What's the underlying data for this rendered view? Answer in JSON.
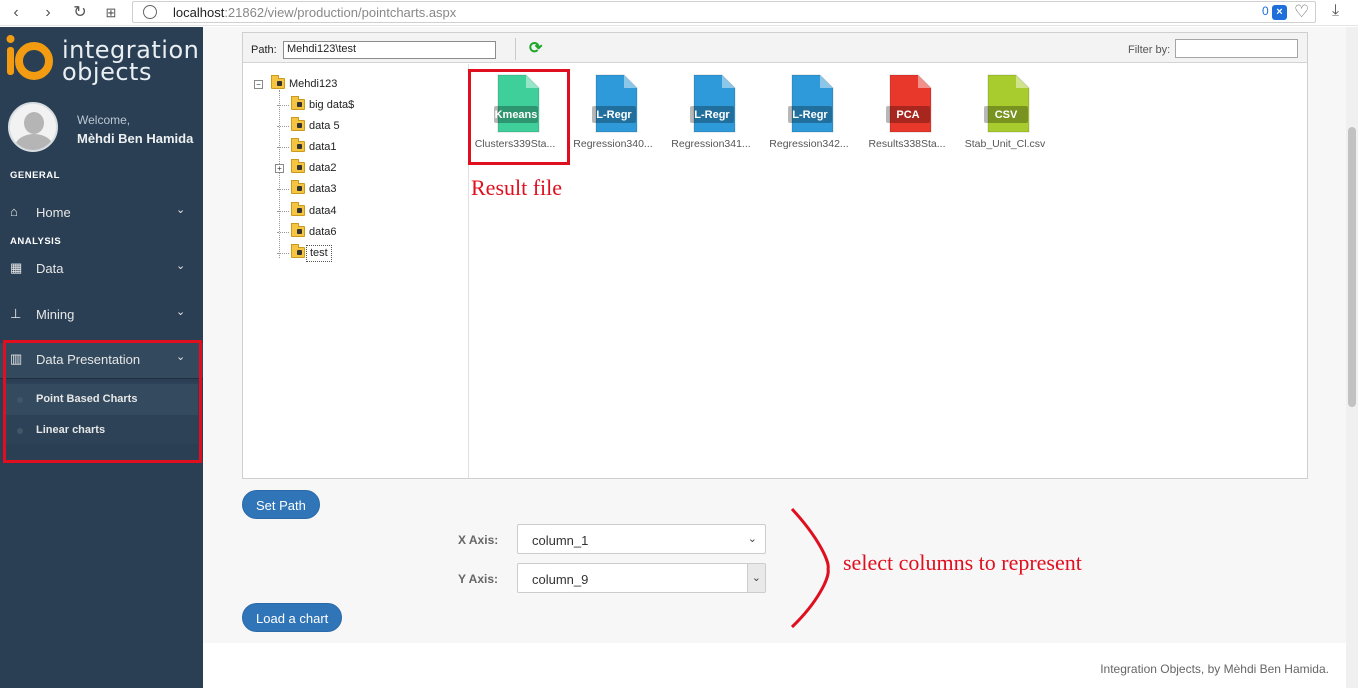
{
  "browser": {
    "url_host": "localhost",
    "url_rest": ":21862/view/production/pointcharts.aspx",
    "badge_count": "0"
  },
  "brand": {
    "logo_line1": "integration",
    "logo_line2": "objects",
    "logo_colors": {
      "orange": "#f39c12",
      "text": "#e9eef2"
    }
  },
  "user": {
    "welcome": "Welcome,",
    "name": "Mèhdi Ben Hamida"
  },
  "sidebar": {
    "section_general": "GENERAL",
    "section_analysis": "ANALYSIS",
    "items": [
      {
        "label": "Home",
        "icon": "home-icon"
      },
      {
        "label": "Data",
        "icon": "table-icon"
      },
      {
        "label": "Mining",
        "icon": "sitemap-icon"
      },
      {
        "label": "Data Presentation",
        "icon": "bar-chart-icon"
      }
    ],
    "submenu": [
      {
        "label": "Point Based Charts"
      },
      {
        "label": "Linear charts"
      }
    ]
  },
  "explorer": {
    "path_label": "Path:",
    "path_value": "Mehdi123\\test",
    "filter_label": "Filter by:",
    "filter_value": "",
    "tree": {
      "root": "Mehdi123",
      "children": [
        "big data$",
        "data 5",
        "data1",
        "data2",
        "data3",
        "data4",
        "data6",
        "test"
      ]
    },
    "files": [
      {
        "tag": "Kmeans",
        "name": "Clusters339Sta...",
        "color": "#3fcf9a"
      },
      {
        "tag": "L-Regr",
        "name": "Regression340...",
        "color": "#2f9ad9"
      },
      {
        "tag": "L-Regr",
        "name": "Regression341...",
        "color": "#2f9ad9"
      },
      {
        "tag": "L-Regr",
        "name": "Regression342...",
        "color": "#2f9ad9"
      },
      {
        "tag": "PCA",
        "name": "Results338Sta...",
        "color": "#e8372b"
      },
      {
        "tag": "CSV",
        "name": "Stab_Unit_Cl.csv",
        "color": "#a8cc2e"
      }
    ]
  },
  "annotations": {
    "result_file": "Result file",
    "select_columns": "select columns to represent"
  },
  "controls": {
    "set_path": "Set Path",
    "x_axis_label": "X Axis:",
    "x_axis_value": "column_1",
    "y_axis_label": "Y Axis:",
    "y_axis_value": "column_9",
    "load_chart": "Load a chart"
  },
  "footer": {
    "text": "Integration Objects, by Mèhdi Ben Hamida."
  }
}
